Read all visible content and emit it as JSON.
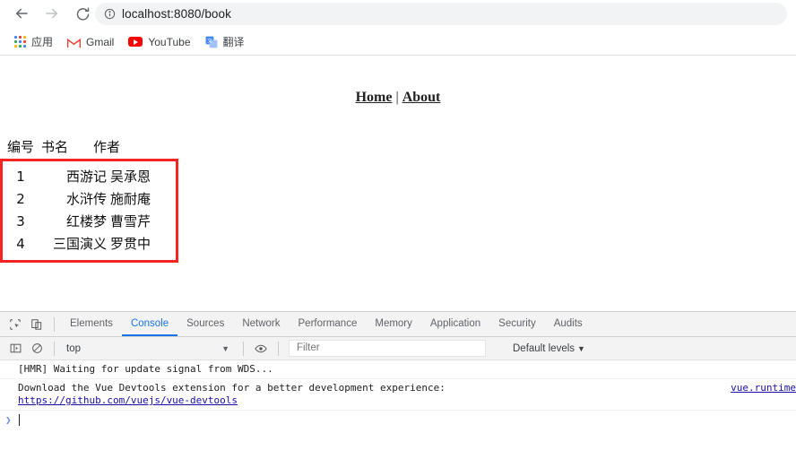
{
  "browser": {
    "back_title": "Back",
    "forward_title": "Forward",
    "reload_title": "Reload",
    "url": "localhost:8080/book",
    "bookmarks": [
      {
        "label": "应用",
        "icon": "apps-grid-icon"
      },
      {
        "label": "Gmail",
        "icon": "gmail-icon"
      },
      {
        "label": "YouTube",
        "icon": "youtube-icon"
      },
      {
        "label": "翻译",
        "icon": "translate-icon"
      }
    ]
  },
  "page": {
    "nav": {
      "home": "Home",
      "separator": "|",
      "about": "About"
    },
    "table": {
      "headers": {
        "id": "编号",
        "name": "书名",
        "author": "作者"
      },
      "rows": [
        {
          "id": "1",
          "name": "西游记",
          "author": "吴承恩"
        },
        {
          "id": "2",
          "name": "水浒传",
          "author": "施耐庵"
        },
        {
          "id": "3",
          "name": "红楼梦",
          "author": "曹雪芹"
        },
        {
          "id": "4",
          "name": "三国演义",
          "author": "罗贯中"
        }
      ],
      "highlight_color": "#f72424"
    }
  },
  "devtools": {
    "tabs": [
      {
        "label": "Elements",
        "active": false
      },
      {
        "label": "Console",
        "active": true
      },
      {
        "label": "Sources",
        "active": false
      },
      {
        "label": "Network",
        "active": false
      },
      {
        "label": "Performance",
        "active": false
      },
      {
        "label": "Memory",
        "active": false
      },
      {
        "label": "Application",
        "active": false
      },
      {
        "label": "Security",
        "active": false
      },
      {
        "label": "Audits",
        "active": false
      }
    ],
    "active_tab_color": "#1a73e8",
    "filterbar": {
      "context": "top",
      "context_caret": "▼",
      "filter_placeholder": "Filter",
      "filter_value": "",
      "levels": "Default levels",
      "levels_caret": "▼"
    },
    "console": {
      "messages": [
        {
          "text": "[HMR] Waiting for update signal from WDS...",
          "link": "",
          "source": ""
        },
        {
          "text": "Download the Vue Devtools extension for a better development experience:",
          "link": "https://github.com/vuejs/vue-devtools",
          "source": "vue.runtime"
        }
      ],
      "prompt_caret": "❯",
      "prompt_value": ""
    }
  }
}
